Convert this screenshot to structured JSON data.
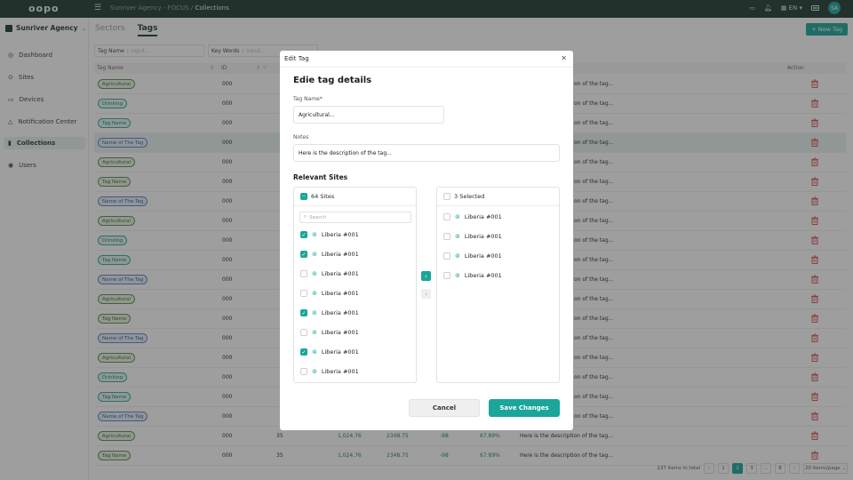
{
  "app": {
    "logo": "oopo",
    "org": "Sunriver Agency"
  },
  "breadcrumb": {
    "parent": "Sunriver Agency - FOCUS",
    "sep": "/",
    "current": "Collections"
  },
  "topbar": {
    "lang": "EN",
    "avatar": "SA"
  },
  "sidebar": {
    "items": [
      {
        "label": "Dashboard",
        "icon": "globe-icon"
      },
      {
        "label": "Sites",
        "icon": "location-pin-icon"
      },
      {
        "label": "Devices",
        "icon": "devices-icon"
      },
      {
        "label": "Notification Center",
        "icon": "warning-icon"
      },
      {
        "label": "Collections",
        "icon": "bookmark-icon"
      },
      {
        "label": "Users",
        "icon": "user-icon"
      }
    ]
  },
  "tabs": [
    "Sectors",
    "Tags"
  ],
  "new_tag": "+ New Tag",
  "filters": {
    "tag_name": "Tag Name",
    "tag_placeholder": "input...",
    "key_words": "Key Words",
    "key_placeholder": "input..."
  },
  "table": {
    "headers": [
      "Tag Name",
      "ID",
      "Action"
    ],
    "rows": [
      {
        "tag": "Agricultural",
        "color": "g",
        "id": "000",
        "desc": "on of the tag..."
      },
      {
        "tag": "Drinking",
        "color": "t",
        "id": "000",
        "desc": "on of the tag..."
      },
      {
        "tag": "Tag Name",
        "color": "t",
        "id": "000",
        "desc": "on of the tag..."
      },
      {
        "tag": "Name of The Tag",
        "color": "b",
        "id": "000",
        "desc": "on of the tag..."
      },
      {
        "tag": "Agricultural",
        "color": "g",
        "id": "000",
        "desc": "on of the tag..."
      },
      {
        "tag": "Tag Name",
        "color": "g",
        "id": "000",
        "desc": "on of the tag..."
      },
      {
        "tag": "Name of The Tag",
        "color": "b",
        "id": "000",
        "desc": "on of the tag..."
      },
      {
        "tag": "Agricultural",
        "color": "g",
        "id": "000",
        "desc": "on of the tag..."
      },
      {
        "tag": "Drinking",
        "color": "t",
        "id": "000",
        "desc": "on of the tag..."
      },
      {
        "tag": "Tag Name",
        "color": "t",
        "id": "000",
        "desc": "on of the tag..."
      },
      {
        "tag": "Name of The Tag",
        "color": "b",
        "id": "000",
        "desc": "on of the tag..."
      },
      {
        "tag": "Agricultural",
        "color": "g",
        "id": "000",
        "desc": "on of the tag..."
      },
      {
        "tag": "Tag Name",
        "color": "g",
        "id": "000",
        "desc": "on of the tag..."
      },
      {
        "tag": "Name of The Tag",
        "color": "b",
        "id": "000",
        "desc": "on of the tag..."
      },
      {
        "tag": "Agricultural",
        "color": "g",
        "id": "000",
        "desc": "on of the tag..."
      },
      {
        "tag": "Drinking",
        "color": "t",
        "id": "000",
        "desc": "on of the tag..."
      },
      {
        "tag": "Tag Name",
        "color": "t",
        "id": "000",
        "desc": "on of the tag..."
      },
      {
        "tag": "Name of The Tag",
        "color": "b",
        "id": "000",
        "desc": "on of the tag..."
      },
      {
        "tag": "Agricultural",
        "color": "g",
        "id": "000",
        "c3": "35",
        "c4": "1,024.76",
        "c5": "2348.75",
        "c6": "-98",
        "c7": "67.89%",
        "desc": "Here is the description of the tag..."
      },
      {
        "tag": "Tag Name",
        "color": "g",
        "id": "000",
        "c3": "35",
        "c4": "1,024.76",
        "c5": "2348.75",
        "c6": "-98",
        "c7": "67.89%",
        "desc": "Here is the description of the tag..."
      }
    ]
  },
  "pagination": {
    "total": "137 items in total",
    "pages": [
      "1",
      "2",
      "3",
      "...",
      "8"
    ],
    "per_page": "20 items/page"
  },
  "modal": {
    "header": "Edit Tag",
    "title": "Edie tag details",
    "tag_name_label": "Tag Name*",
    "tag_name_value": "Agricultural...",
    "notes_label": "Notes",
    "notes_value": "Here is the description of the tag...",
    "relevant_sites": "Relevant Sites",
    "left": {
      "header": "64 Sites",
      "search_placeholder": "Search",
      "items": [
        {
          "label": "Liberia #001",
          "checked": true
        },
        {
          "label": "Liberia #001",
          "checked": true
        },
        {
          "label": "Liberia #001",
          "checked": false
        },
        {
          "label": "Liberia #001",
          "checked": false
        },
        {
          "label": "Liberia #001",
          "checked": true
        },
        {
          "label": "Liberia #001",
          "checked": false
        },
        {
          "label": "Liberia #001",
          "checked": true
        },
        {
          "label": "Liberia #001",
          "checked": false
        }
      ]
    },
    "right": {
      "header": "3 Selected",
      "items": [
        "Liberia #001",
        "Liberia #001",
        "Liberia #001",
        "Liberia #001"
      ]
    },
    "cancel": "Cancel",
    "save": "Save Changes"
  },
  "colors": {
    "accent": "#1aa69a",
    "topbar": "#1f3a32",
    "danger": "#d9534f"
  }
}
